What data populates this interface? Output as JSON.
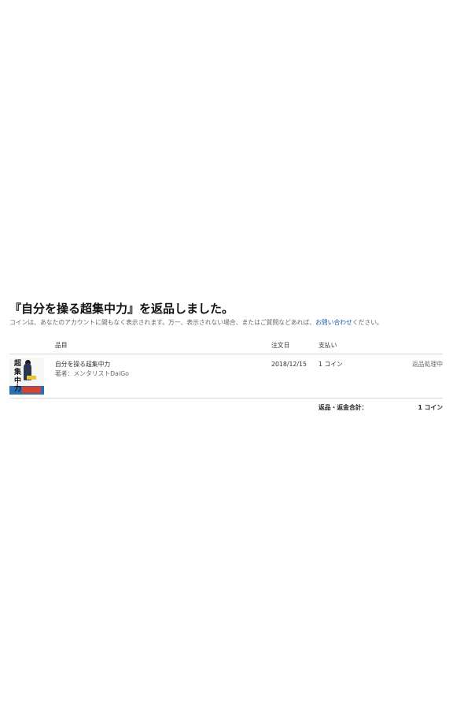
{
  "page": {
    "title": "『自分を操る超集中力』を返品しました。",
    "notice_prefix": "コインは、あなたのアカウントに間もなく表示されます。万一、表示されない場合、またはご質問などあれば、",
    "notice_link": "お問い合わせ",
    "notice_suffix": "ください。"
  },
  "table": {
    "headers": {
      "item": "品目",
      "order_date": "注文日",
      "payment": "支払い"
    },
    "rows": [
      {
        "title": "自分を操る超集中力",
        "author": "著者：メンタリストDaiGo",
        "order_date": "2018/12/15",
        "payment": "1 コイン",
        "status": "返品処理中",
        "cover": {
          "text_chars": [
            "超",
            "集",
            "中",
            "力"
          ],
          "colors": {
            "band": "#2c6fb0",
            "accent": "#d9402e"
          }
        }
      }
    ]
  },
  "summary": {
    "label": "返品・返金合計：",
    "value": "1 コイン"
  }
}
